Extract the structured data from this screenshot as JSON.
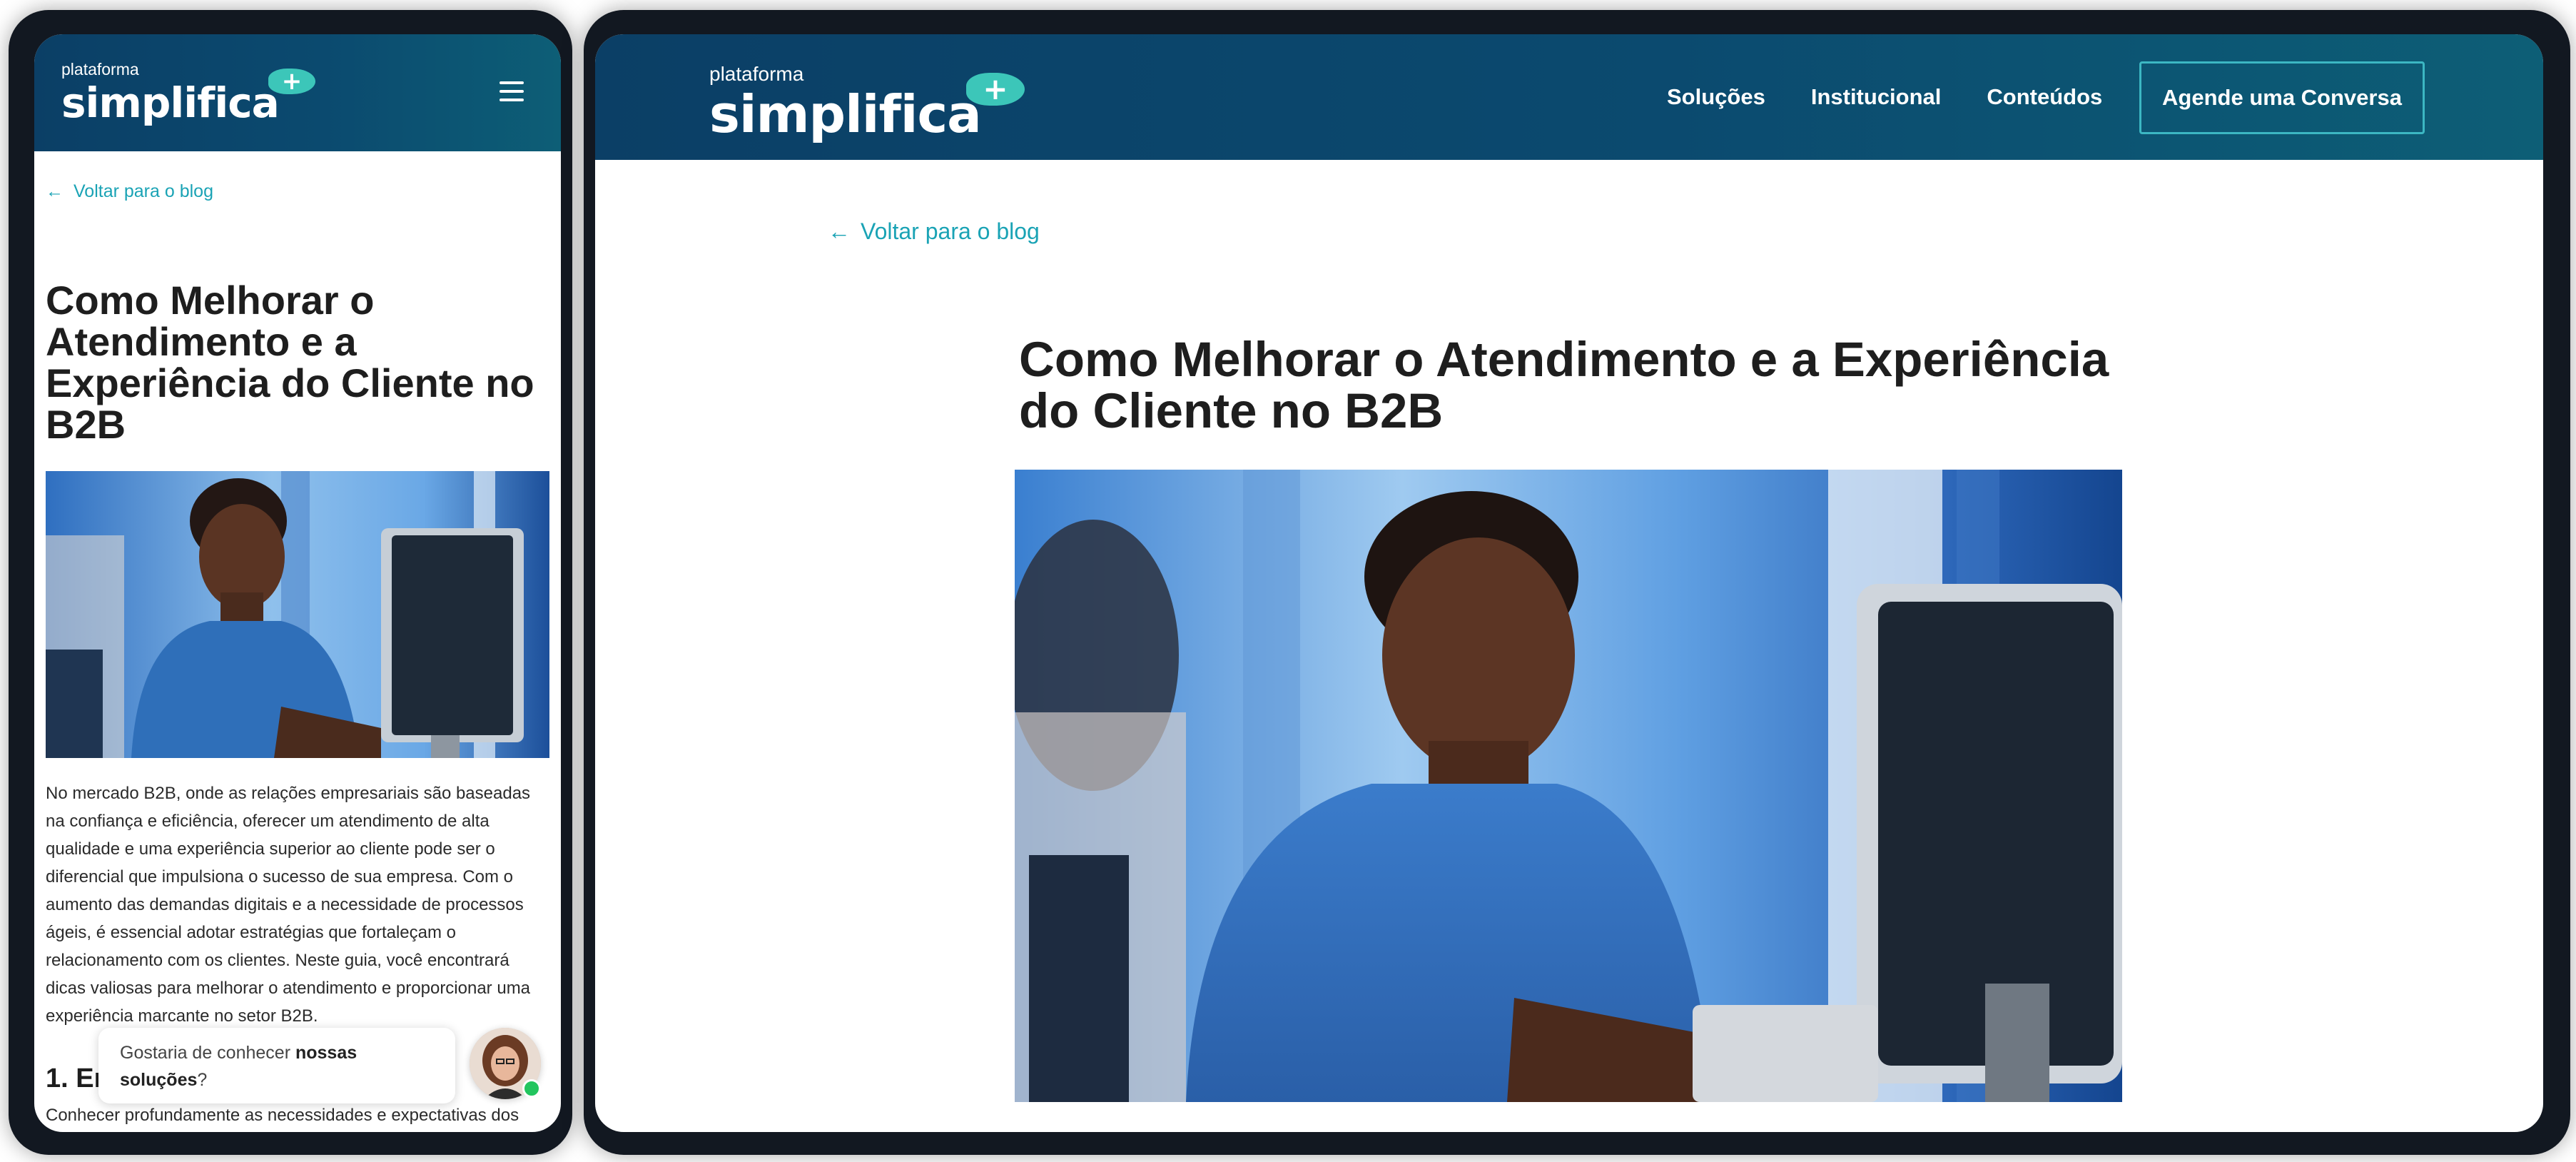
{
  "brand": {
    "logo_top": "plataforma",
    "logo_word": "simplifica",
    "plus_symbol": "+",
    "accent_color": "#3cc6b9",
    "header_color": "#0b4a6f",
    "link_color": "#1aa3b5"
  },
  "nav": {
    "items": [
      "Soluções",
      "Institucional",
      "Conteúdos"
    ],
    "cta": "Agende uma Conversa",
    "menu_icon": "hamburger-icon"
  },
  "article": {
    "back_arrow": "←",
    "back_link": "Voltar para o blog",
    "title": "Como Melhorar o Atendimento e a Experiência do Cliente no B2B",
    "intro": "No mercado B2B, onde as relações empresariais são baseadas na confiança e eficiência, oferecer um atendimento de alta qualidade e uma experiência superior ao cliente pode ser o diferencial que impulsiona o sucesso de sua empresa. Com o aumento das demandas digitais e a necessidade de processos ágeis, é essencial adotar estratégias que fortaleçam o relacionamento com os clientes. Neste guia, você encontrará dicas valiosas para melhorar o atendimento e proporcionar uma experiência marcante no setor B2B.",
    "section_heading_visible": "1. En",
    "section_text_visible": "Conhecer profundamente as necessidades e expectativas dos"
  },
  "chat": {
    "prefix": "Gostaria de conhecer ",
    "bold": "nossas soluções",
    "suffix": "?"
  }
}
